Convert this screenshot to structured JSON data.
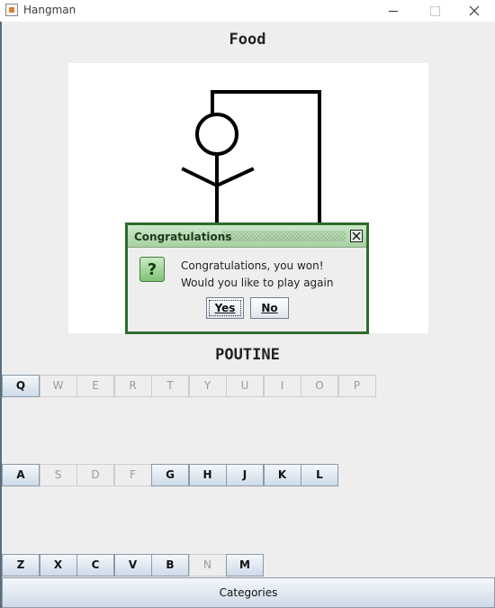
{
  "window": {
    "title": "Hangman"
  },
  "game": {
    "category": "Food",
    "word": "POUTINE"
  },
  "dialog": {
    "title": "Congratulations",
    "message_line1": "Congratulations, you won!",
    "message_line2": "Would you like to play again",
    "yes_label": "Yes",
    "no_label": "No",
    "icon": "question-icon"
  },
  "keyboard": {
    "row1": [
      {
        "letter": "Q",
        "enabled": true
      },
      {
        "letter": "W",
        "enabled": false
      },
      {
        "letter": "E",
        "enabled": false
      },
      {
        "letter": "R",
        "enabled": false
      },
      {
        "letter": "T",
        "enabled": false
      },
      {
        "letter": "Y",
        "enabled": false
      },
      {
        "letter": "U",
        "enabled": false
      },
      {
        "letter": "I",
        "enabled": false
      },
      {
        "letter": "O",
        "enabled": false
      },
      {
        "letter": "P",
        "enabled": false
      }
    ],
    "row2": [
      {
        "letter": "A",
        "enabled": true
      },
      {
        "letter": "S",
        "enabled": false
      },
      {
        "letter": "D",
        "enabled": false
      },
      {
        "letter": "F",
        "enabled": false
      },
      {
        "letter": "G",
        "enabled": true
      },
      {
        "letter": "H",
        "enabled": true
      },
      {
        "letter": "J",
        "enabled": true
      },
      {
        "letter": "K",
        "enabled": true
      },
      {
        "letter": "L",
        "enabled": true
      }
    ],
    "row3": [
      {
        "letter": "Z",
        "enabled": true
      },
      {
        "letter": "X",
        "enabled": true
      },
      {
        "letter": "C",
        "enabled": true
      },
      {
        "letter": "V",
        "enabled": true
      },
      {
        "letter": "B",
        "enabled": true
      },
      {
        "letter": "N",
        "enabled": false
      },
      {
        "letter": "M",
        "enabled": true
      }
    ]
  },
  "footer": {
    "categories_label": "Categories"
  },
  "colors": {
    "dialog_border": "#2f6b2c",
    "dialog_title_bg": "#b8dcb3",
    "key_enabled": "#dce6f0"
  }
}
